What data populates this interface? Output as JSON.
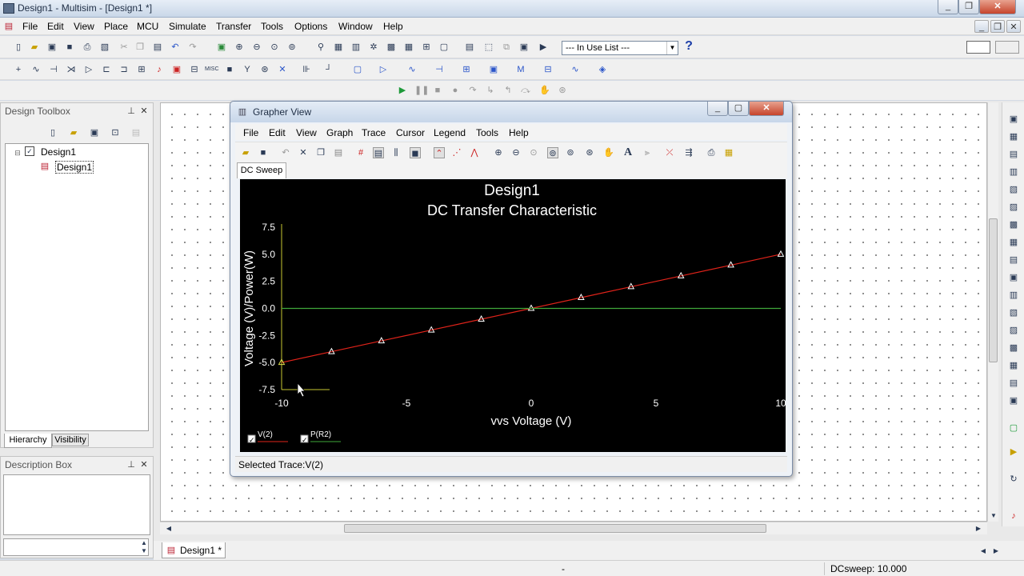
{
  "window": {
    "title": "Design1 - Multisim - [Design1 *]"
  },
  "menu": [
    "File",
    "Edit",
    "View",
    "Place",
    "MCU",
    "Simulate",
    "Transfer",
    "Tools",
    "Options",
    "Window",
    "Help"
  ],
  "toolbar": {
    "in_use_list": "--- In Use List ---",
    "help_glyph": "?"
  },
  "design_toolbox": {
    "title": "Design Toolbox",
    "tree_root": "Design1",
    "tree_child": "Design1",
    "tabs": [
      "Hierarchy",
      "Visibility"
    ]
  },
  "description_box": {
    "title": "Description Box"
  },
  "doc_tab": "Design1 *",
  "statusbar": {
    "dash": "-",
    "dcsweep": "DCsweep: 10.000"
  },
  "grapher": {
    "title": "Grapher View",
    "menu": [
      "File",
      "Edit",
      "View",
      "Graph",
      "Trace",
      "Cursor",
      "Legend",
      "Tools",
      "Help"
    ],
    "tab": "DC Sweep",
    "status": "Selected Trace:V(2)",
    "text_tool": "A"
  },
  "chart_data": {
    "type": "line",
    "title": "Design1",
    "subtitle": "DC Transfer Characteristic",
    "xlabel": "vvs Voltage (V)",
    "ylabel": "Voltage (V)/Power(W)",
    "xlim": [
      -10,
      10
    ],
    "ylim": [
      -7.5,
      7.5
    ],
    "x_ticks": [
      "-10",
      "-5",
      "0",
      "5",
      "10"
    ],
    "y_ticks": [
      "7.5",
      "5.0",
      "2.5",
      "0.0",
      "-2.5",
      "-5.0",
      "-7.5"
    ],
    "series": [
      {
        "name": "V(2)",
        "color": "#e0231a",
        "x": [
          -10,
          -8,
          -6,
          -4,
          -2,
          0,
          2,
          4,
          6,
          8,
          10
        ],
        "y": [
          -5,
          -4,
          -3,
          -2,
          -1,
          0,
          1,
          2,
          3,
          4,
          5
        ]
      },
      {
        "name": "P(R2)",
        "color": "#3fa83a",
        "x": [
          -10,
          10
        ],
        "y": [
          0,
          0
        ]
      }
    ],
    "legend": [
      "V(2)",
      "P(R2)"
    ],
    "legend_position": "bottom-left",
    "grid": false
  }
}
